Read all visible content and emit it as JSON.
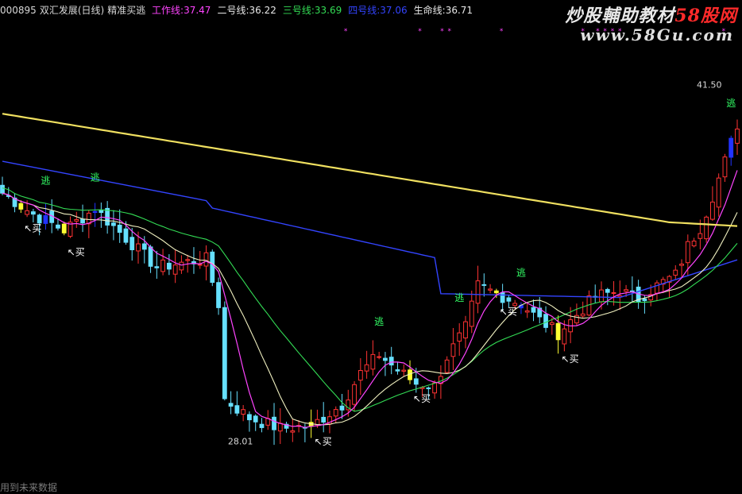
{
  "header": {
    "code": "000895",
    "name": "双汇发展(日线)",
    "indicator": "精准买逃",
    "lines": [
      {
        "label": "工作线:",
        "value": "37.47",
        "color": "#ff44ff"
      },
      {
        "label": "二号线:",
        "value": "36.22",
        "color": "#e8e8e8"
      },
      {
        "label": "三号线:",
        "value": "33.69",
        "color": "#33dd55"
      },
      {
        "label": "四号线:",
        "value": "37.06",
        "color": "#3344ff"
      },
      {
        "label": "生命线:",
        "value": "36.71",
        "color": "#e8e8e8"
      }
    ]
  },
  "watermark": {
    "brand_main": "炒股輔助教材",
    "brand_accent": "58股网",
    "url": "www.58Gu.com"
  },
  "footer": "用到未来数据",
  "colors": {
    "background": "#000000",
    "up_candle": "#ff3333",
    "down_candle": "#66e0ff",
    "buy_candle": "#ffff33",
    "escape_candle": "#2233ff",
    "lifeline": "#f0e060",
    "fourth_line": "#3344ff",
    "third_line": "#33dd55",
    "second_line": "#f0f0c0",
    "work_line": "#ff44ff",
    "signal_text": "#33ff66",
    "buy_text": "#ffffff"
  },
  "chart_data": {
    "type": "candlestick",
    "y_range": [
      26.5,
      43.5
    ],
    "candle_count": 120,
    "price_labels": [
      {
        "text": "41.50",
        "index": 117,
        "price": 41.5,
        "kind": "high"
      },
      {
        "text": "28.01",
        "index": 36,
        "price": 28.01,
        "kind": "low"
      }
    ],
    "escape_signals": [
      {
        "text": "逃",
        "index": 7
      },
      {
        "text": "逃",
        "index": 15
      },
      {
        "text": "逃",
        "index": 61
      },
      {
        "text": "逃",
        "index": 74
      },
      {
        "text": "逃",
        "index": 84
      },
      {
        "text": "逃",
        "index": 118
      }
    ],
    "buy_signals": [
      {
        "text": "买",
        "index": 3
      },
      {
        "text": "买",
        "index": 10
      },
      {
        "text": "买",
        "index": 50
      },
      {
        "text": "买",
        "index": 66
      },
      {
        "text": "买",
        "index": 80
      },
      {
        "text": "买",
        "index": 90
      }
    ],
    "magenta_markers": [
      23,
      33,
      36,
      37,
      44,
      55,
      57,
      58,
      59,
      60,
      74,
      81,
      95
    ]
  }
}
